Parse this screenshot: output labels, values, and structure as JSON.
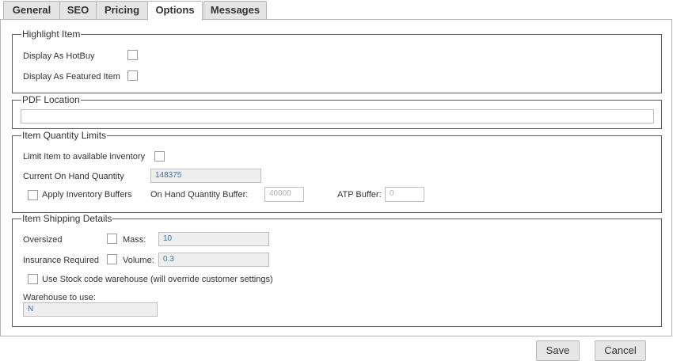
{
  "tabs": [
    "General",
    "SEO",
    "Pricing",
    "Options",
    "Messages"
  ],
  "active_tab": "Options",
  "highlight": {
    "legend": "Highlight Item",
    "hotbuy_label": "Display As HotBuy",
    "featured_label": "Display As Featured Item"
  },
  "pdf": {
    "legend": "PDF Location",
    "value": ""
  },
  "quantity": {
    "legend": "Item Quantity Limits",
    "limit_label": "Limit Item to available inventory",
    "on_hand_label": "Current On Hand Quantity",
    "on_hand_value": "148375",
    "buffers_label": "Apply Inventory Buffers",
    "on_hand_buffer_label": "On Hand Quantity Buffer:",
    "on_hand_buffer_value": "40000",
    "atp_label": "ATP Buffer:",
    "atp_value": "0"
  },
  "shipping": {
    "legend": "Item Shipping Details",
    "oversized_label": "Oversized",
    "mass_label": "Mass:",
    "mass_value": "10",
    "insurance_label": "Insurance Required",
    "volume_label": "Volume:",
    "volume_value": "0.3",
    "stock_code_label": "Use Stock code warehouse (will override customer settings)",
    "warehouse_label": "Warehouse to use:",
    "warehouse_value": "N"
  },
  "buttons": {
    "save": "Save",
    "cancel": "Cancel"
  }
}
